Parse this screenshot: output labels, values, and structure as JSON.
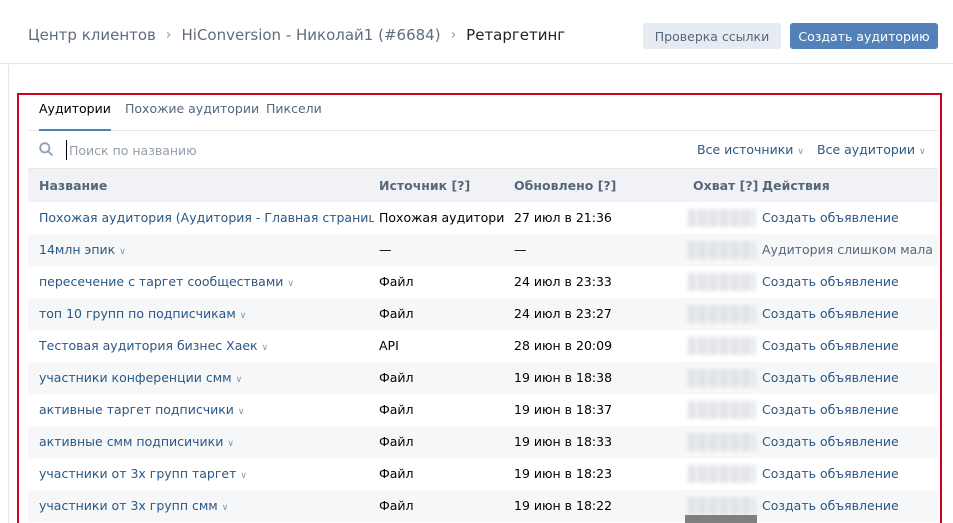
{
  "breadcrumb": [
    "Центр клиентов",
    "HiConversion - Николай1 (#6684)",
    "Ретаргетинг"
  ],
  "buttons": {
    "check_link": "Проверка ссылки",
    "create_audience": "Создать аудиторию"
  },
  "tabs": [
    "Аудитории",
    "Похожие аудитории",
    "Пиксели"
  ],
  "search": {
    "placeholder": "Поиск по названию",
    "value": ""
  },
  "filters": {
    "sources": "Все источники",
    "audiences": "Все аудитории"
  },
  "columns": {
    "name": "Название",
    "source": "Источник [?]",
    "updated": "Обновлено [?]",
    "reach": "Охват [?]",
    "actions": "Действия"
  },
  "rows": [
    {
      "name": "Похожая аудитория (Аудитория - Главная страница -...",
      "dropdown": false,
      "source": "Похожая аудитория",
      "updated": "27 июл в 21:36",
      "action": "Создать объявление",
      "muted": false
    },
    {
      "name": "14млн эпик",
      "dropdown": true,
      "source": "—",
      "updated": "—",
      "action": "Аудитория слишком мала",
      "muted": true
    },
    {
      "name": "пересечение с таргет сообществами",
      "dropdown": true,
      "source": "Файл",
      "updated": "24 июл в 23:33",
      "action": "Создать объявление",
      "muted": false
    },
    {
      "name": "топ 10 групп по подписчикам",
      "dropdown": true,
      "source": "Файл",
      "updated": "24 июл в 23:27",
      "action": "Создать объявление",
      "muted": false
    },
    {
      "name": "Тестовая аудитория бизнес Хаек",
      "dropdown": true,
      "source": "API",
      "updated": "28 июн в 20:09",
      "action": "Создать объявление",
      "muted": false
    },
    {
      "name": "участники конференции смм",
      "dropdown": true,
      "source": "Файл",
      "updated": "19 июн в 18:38",
      "action": "Создать объявление",
      "muted": false
    },
    {
      "name": "активные таргет подписчики",
      "dropdown": true,
      "source": "Файл",
      "updated": "19 июн в 18:37",
      "action": "Создать объявление",
      "muted": false
    },
    {
      "name": "активные смм подписичики",
      "dropdown": true,
      "source": "Файл",
      "updated": "19 июн в 18:33",
      "action": "Создать объявление",
      "muted": false
    },
    {
      "name": "участники от 3х групп таргет",
      "dropdown": true,
      "source": "Файл",
      "updated": "19 июн в 18:23",
      "action": "Создать объявление",
      "muted": false
    },
    {
      "name": "участники от 3х групп смм",
      "dropdown": true,
      "source": "Файл",
      "updated": "19 июн в 18:22",
      "action": "Создать объявление",
      "muted": false
    }
  ],
  "colors": {
    "accent": "#5181b8",
    "link": "#2a5885",
    "highlight_border": "#d0021b"
  }
}
